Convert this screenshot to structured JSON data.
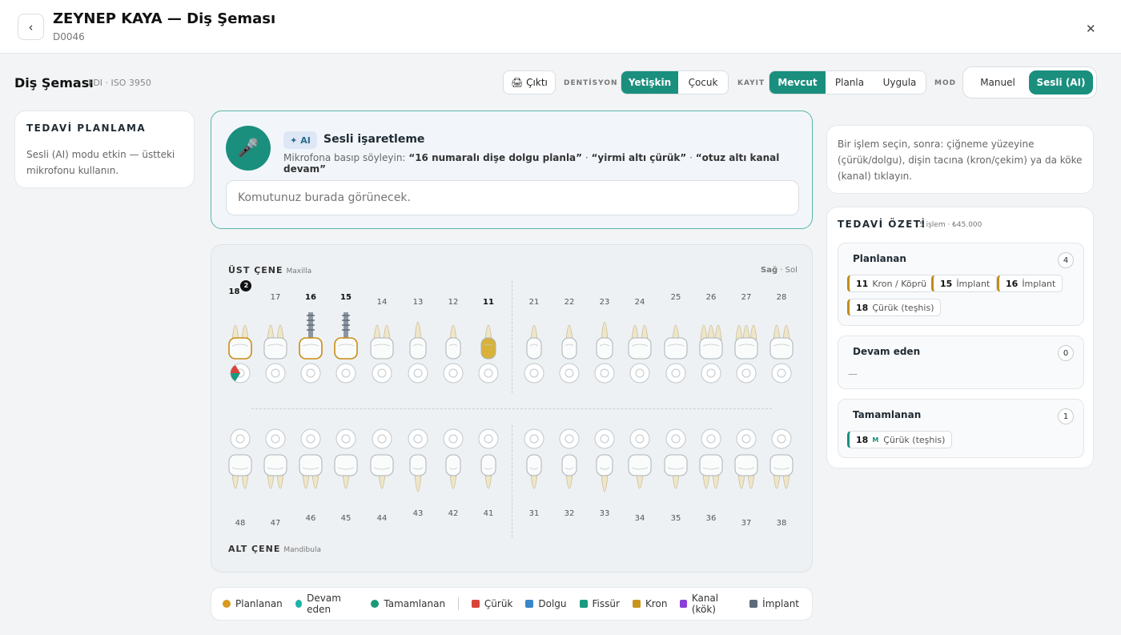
{
  "header": {
    "back_icon": "‹",
    "title": "ZEYNEP KAYA — Diş Şeması",
    "patient_id": "D0046",
    "close_icon": "✕"
  },
  "toolbar": {
    "title": "Diş Şeması",
    "standard": "FDI · ISO 3950",
    "print_label": "🖨 Çıktı",
    "dentition_label": "DENTİSYON",
    "dentition_options": [
      "Yetişkin",
      "Çocuk"
    ],
    "dentition_selected": "Yetişkin",
    "record_label": "KAYIT",
    "record_options": [
      "Mevcut",
      "Planla",
      "Uygula"
    ],
    "record_selected": "Mevcut",
    "mode_label": "MOD",
    "mode_options": [
      "Manuel",
      "Sesli (AI)"
    ],
    "mode_selected": "Sesli (AI)"
  },
  "treatment_planning": {
    "title": "TEDAVİ PLANLAMA",
    "body": "Sesli (AI) modu etkin — üstteki mikrofonu kullanın."
  },
  "voice": {
    "mic_icon": "🎤",
    "badge": "✦ AI",
    "title": "Sesli işaretleme",
    "hint_prefix": "Mikrofona basıp söyleyin:",
    "examples": [
      "“16 numaralı dişe dolgu planla”",
      "“yirmi altı çürük”",
      "“otuz altı kanal devam”"
    ],
    "input_placeholder": "Komutunuz burada görünecek."
  },
  "chart": {
    "upper_jaw": "ÜST ÇENE",
    "upper_jaw_sub": "Maxilla",
    "lower_jaw": "ALT ÇENE",
    "lower_jaw_sub": "Mandibula",
    "side_right": "Sağ",
    "side_sep": " · ",
    "side_left": "Sol",
    "upper_teeth": [
      {
        "n": "18",
        "roots": 2,
        "status": "planned",
        "bold": true,
        "count": "2",
        "caries": true
      },
      {
        "n": "17",
        "roots": 2
      },
      {
        "n": "16",
        "implant": true,
        "status": "planned",
        "bold": true
      },
      {
        "n": "15",
        "implant": true,
        "status": "planned",
        "bold": true
      },
      {
        "n": "14",
        "roots": 2
      },
      {
        "n": "13",
        "roots": 1,
        "canine": true
      },
      {
        "n": "12",
        "roots": 1,
        "incisor": true
      },
      {
        "n": "11",
        "roots": 1,
        "incisor": true,
        "crown": true,
        "bold": true
      },
      {
        "n": "21",
        "roots": 1,
        "incisor": true
      },
      {
        "n": "22",
        "roots": 1,
        "incisor": true
      },
      {
        "n": "23",
        "roots": 1,
        "canine": true
      },
      {
        "n": "24",
        "roots": 2
      },
      {
        "n": "25",
        "roots": 1
      },
      {
        "n": "26",
        "roots": 3
      },
      {
        "n": "27",
        "roots": 3
      },
      {
        "n": "28",
        "roots": 2
      }
    ],
    "lower_teeth": [
      {
        "n": "48",
        "roots": 2
      },
      {
        "n": "47",
        "roots": 2
      },
      {
        "n": "46",
        "roots": 2
      },
      {
        "n": "45",
        "roots": 1
      },
      {
        "n": "44",
        "roots": 1
      },
      {
        "n": "43",
        "roots": 1,
        "canine": true
      },
      {
        "n": "42",
        "roots": 1,
        "incisor": true
      },
      {
        "n": "41",
        "roots": 1,
        "incisor": true
      },
      {
        "n": "31",
        "roots": 1,
        "incisor": true
      },
      {
        "n": "32",
        "roots": 1,
        "incisor": true
      },
      {
        "n": "33",
        "roots": 1,
        "canine": true
      },
      {
        "n": "34",
        "roots": 1
      },
      {
        "n": "35",
        "roots": 1
      },
      {
        "n": "36",
        "roots": 2
      },
      {
        "n": "37",
        "roots": 2
      },
      {
        "n": "38",
        "roots": 2
      }
    ]
  },
  "legend": {
    "status": [
      {
        "label": "Planlanan",
        "color": "#d99a1e"
      },
      {
        "label": "Devam eden",
        "color": "#1fb2a8"
      },
      {
        "label": "Tamamlanan",
        "color": "#189a77"
      }
    ],
    "procedures": [
      {
        "label": "Çürük",
        "color": "#d9443a"
      },
      {
        "label": "Dolgu",
        "color": "#3b86c9"
      },
      {
        "label": "Fissür",
        "color": "#1a9a80"
      },
      {
        "label": "Kron",
        "color": "#c9941e"
      },
      {
        "label": "Kanal (kök)",
        "color": "#8a3fd6"
      },
      {
        "label": "İmplant",
        "color": "#5e6b7a"
      }
    ]
  },
  "info": "Bir işlem seçin, sonra: çiğneme yüzeyine (çürük/dolgu), dişin tacına (kron/çekim) ya da köke (kanal) tıklayın.",
  "summary": {
    "title": "TEDAVİ ÖZETİ",
    "subtitle": "5 işlem · ₺45.000",
    "groups": [
      {
        "title": "Planlanan",
        "count": "4",
        "items": [
          {
            "tooth": "11",
            "label": "Kron / Köprü"
          },
          {
            "tooth": "15",
            "label": "İmplant"
          },
          {
            "tooth": "16",
            "label": "İmplant"
          },
          {
            "tooth": "18",
            "label": "Çürük (teşhis)"
          }
        ]
      },
      {
        "title": "Devam eden",
        "count": "0",
        "empty": "—"
      },
      {
        "title": "Tamamlanan",
        "count": "1",
        "items": [
          {
            "tooth": "18",
            "tag": "M",
            "label": "Çürük (teşhis)"
          }
        ]
      }
    ]
  }
}
